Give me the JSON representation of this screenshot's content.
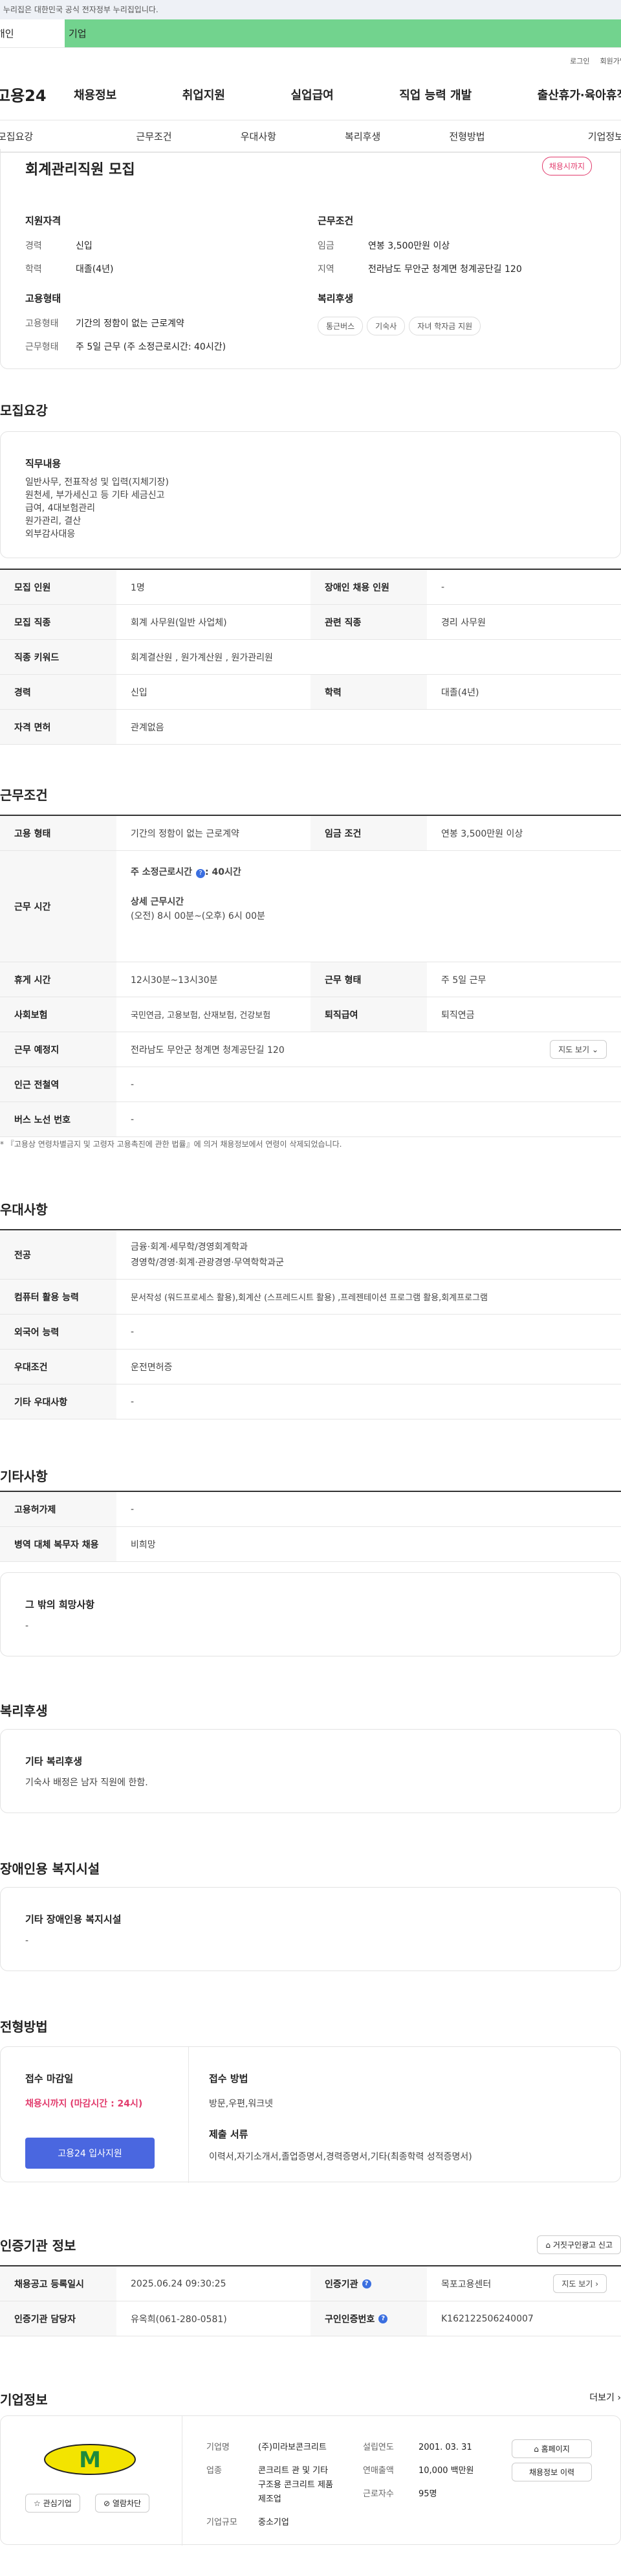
{
  "gov_bar": "이 누리집은 대한민국 공식 전자정부 누리집입니다.",
  "banner": {
    "left": "개인",
    "right": "기업"
  },
  "util": [
    "로그인",
    "회원가입"
  ],
  "gnb": {
    "logo": "고용24",
    "items": [
      "채용정보",
      "취업지원",
      "실업급여",
      "직업 능력 개발",
      "출산휴가·육아휴직"
    ]
  },
  "tabs": [
    "모집요강",
    "근무조건",
    "우대사항",
    "복리후생",
    "전형방법",
    "기업정보"
  ],
  "summary": {
    "title": "회계관리직원 모집",
    "dday": "채용시까지",
    "qual_title": "지원자격",
    "qual": [
      {
        "k": "경력",
        "v": "신입"
      },
      {
        "k": "학력",
        "v": "대졸(4년)"
      }
    ],
    "cond_title": "근무조건",
    "cond": [
      {
        "k": "임금",
        "v": "연봉 3,500만원 이상"
      },
      {
        "k": "지역",
        "v": "전라남도 무안군 청계면 청계공단길 120"
      }
    ],
    "emp_title": "고용형태",
    "emp": [
      {
        "k": "고용형태",
        "v": "기간의 정함이 없는 근로계약"
      },
      {
        "k": "근무형태",
        "v": "주 5일 근무 (주 소정근로시간: 40시간)"
      }
    ],
    "welfare_title": "복리후생",
    "welfare": [
      "통근버스",
      "기숙사",
      "자녀 학자금 지원"
    ]
  },
  "recruit": {
    "title": "모집요강",
    "duty_title": "직무내용",
    "duty": [
      "일반사무, 전표작성 및 입력(지체기장)",
      "원천세, 부가세신고 등 기타 세금신고",
      "급여, 4대보험관리",
      "원가관리, 결산",
      "외부감사대응"
    ],
    "rows": [
      [
        {
          "k": "모집 인원",
          "v": "1명"
        },
        {
          "k": "장애인 채용 인원",
          "v": "-"
        }
      ],
      [
        {
          "k": "모집 직종",
          "v": "회계 사무원(일반 사업체)"
        },
        {
          "k": "관련 직종",
          "v": "경리 사무원"
        }
      ],
      [
        {
          "k": "직종 키워드",
          "v": "회계결산원 , 원가계산원 , 원가관리원"
        }
      ],
      [
        {
          "k": "경력",
          "v": "신입"
        },
        {
          "k": "학력",
          "v": "대졸(4년)"
        }
      ],
      [
        {
          "k": "자격 면허",
          "v": "관계없음"
        }
      ]
    ]
  },
  "work": {
    "title": "근무조건",
    "emp_type_k": "고용 형태",
    "emp_type_v": "기간의 정함이 없는 근로계약",
    "wage_k": "임금 조건",
    "wage_v": "연봉 3,500만원 이상",
    "hours_k": "근무 시간",
    "hours_week": "주 소정근로시간",
    "hours_week_v": ": 40시간",
    "hours_detail_t": "상세 근무시간",
    "hours_detail": "(오전) 8시 00분~(오후) 6시 00분",
    "break_k": "휴게 시간",
    "break_v": "12시30분~13시30분",
    "shift_k": "근무 형태",
    "shift_v": "주 5일 근무",
    "ins_k": "사회보험",
    "ins_v": "국민연금, 고용보험, 산재보험, 건강보험",
    "ret_k": "퇴직급여",
    "ret_v": "퇴직연금",
    "place_k": "근무 예정지",
    "place_v": "전라남도 무안군 청계면 청계공단길 120",
    "map_btn": "지도 보기",
    "sub_k": "인근 전철역",
    "sub_v": "-",
    "bus_k": "버스 노선 번호",
    "bus_v": "-",
    "note": "* 『고용상 연령차별금지 및 고령자 고용촉진에 관한 법률』에 의거 채용정보에서 연령이 삭제되었습니다."
  },
  "pref": {
    "title": "우대사항",
    "rows": [
      {
        "k": "전공",
        "v": [
          "금융·회계·세무학/경영회계학과",
          "경영학/경영·회계·관광경영·무역학학과군"
        ]
      },
      {
        "k": "컴퓨터 활용 능력",
        "v": [
          "문서작성 (워드프로세스 활용),회계산 (스프레드시트 활용) ,프레젠테이션 프로그램 활용,회계프로그램"
        ]
      },
      {
        "k": "외국어 능력",
        "v": [
          "-"
        ]
      },
      {
        "k": "우대조건",
        "v": [
          "운전면허증"
        ]
      },
      {
        "k": "기타 우대사항",
        "v": [
          "-"
        ]
      }
    ]
  },
  "etc": {
    "title": "기타사항",
    "rows": [
      {
        "k": "고용허가제",
        "v": "-"
      },
      {
        "k": "병역 대체 복무자 채용",
        "v": "비희망"
      }
    ],
    "hope_t": "그 밖의 희망사항",
    "hope_v": "-"
  },
  "welfare": {
    "title": "복리후생",
    "box_t": "기타 복리후생",
    "box_v": "기숙사 배정은 남자 직원에 한함."
  },
  "disabled": {
    "title": "장애인용 복지시설",
    "box_t": "기타 장애인용 복지시설",
    "box_v": "-"
  },
  "process": {
    "title": "전형방법",
    "deadline_t": "접수 마감일",
    "deadline_v": "채용시까지 (마감시간 : 24시)",
    "apply_btn": "고용24 입사지원",
    "method_t": "접수 방법",
    "method_v": "방문,우편,워크넷",
    "docs_t": "제출 서류",
    "docs_v": "이력서,자기소개서,졸업증명서,경력증명서,기타(최종학력 성적증명서)"
  },
  "cert": {
    "title": "인증기관 정보",
    "report_btn": "거짓구인광고 신고",
    "r1": [
      {
        "k": "채용공고 등록일시",
        "v": "2025.06.24 09:30:25"
      },
      {
        "k": "인증기관",
        "v": "목포고용센터"
      }
    ],
    "map_btn": "지도 보기",
    "r2": [
      {
        "k": "인증기관 담당자",
        "v": "유옥희(061-280-0581)"
      },
      {
        "k": "구인인증번호",
        "v": "K162122506240007"
      }
    ]
  },
  "company": {
    "title": "기업정보",
    "more": "더보기",
    "fav_btn": "관심기업",
    "block_btn": "열람차단",
    "f": [
      {
        "k": "기업명",
        "v": "(주)미라보콘크리트"
      },
      {
        "k": "업종",
        "v": "콘크리트 관 및 기타 구조용 콘크리트 제품 제조업"
      },
      {
        "k": "기업규모",
        "v": "중소기업"
      }
    ],
    "g": [
      {
        "k": "설립연도",
        "v": "2001. 03. 31"
      },
      {
        "k": "연매출액",
        "v": "10,000 백만원"
      },
      {
        "k": "근로자수",
        "v": "95명"
      }
    ],
    "home_btn": "홈페이지",
    "hist_btn": "채용정보 이력"
  }
}
